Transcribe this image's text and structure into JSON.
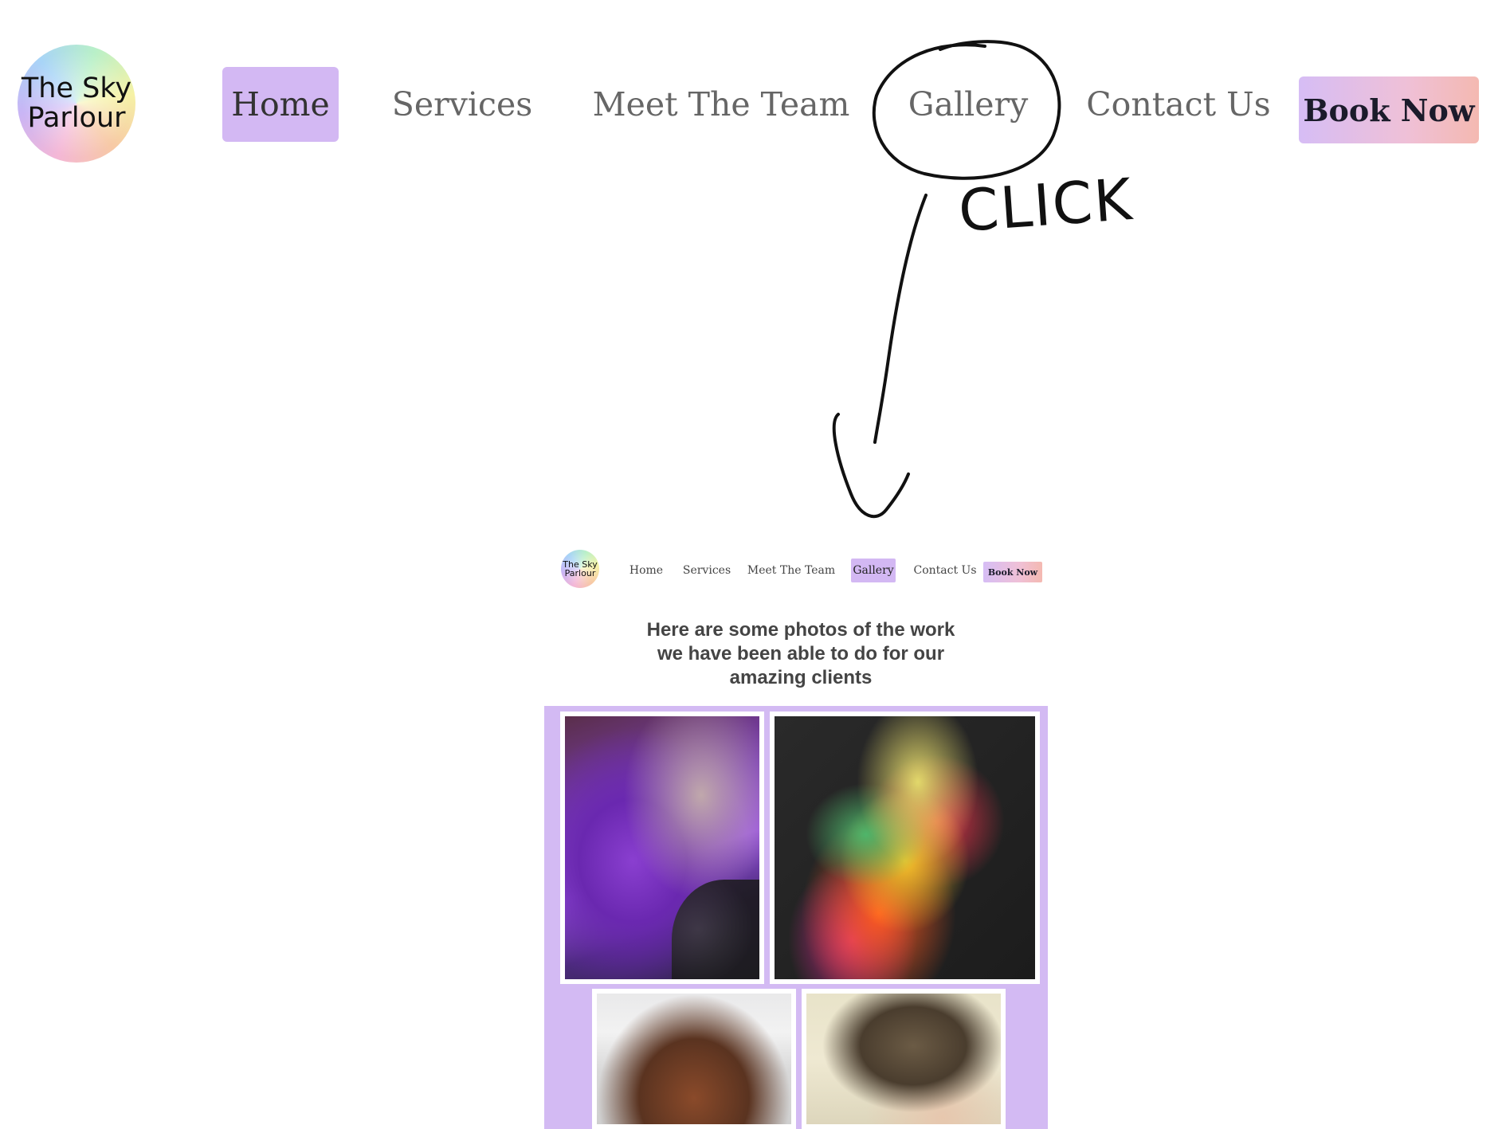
{
  "header_large": {
    "logo": {
      "line1": "The Sky",
      "line2": "Parlour"
    },
    "nav": {
      "home": "Home",
      "services": "Services",
      "team": "Meet The Team",
      "gallery": "Gallery",
      "contact": "Contact Us",
      "book": "Book Now"
    },
    "active_item": "Home"
  },
  "annotation": {
    "text": "CLICK"
  },
  "preview": {
    "logo": {
      "line1": "The Sky",
      "line2": "Parlour"
    },
    "nav": {
      "home": "Home",
      "services": "Services",
      "team": "Meet The Team",
      "gallery": "Gallery",
      "contact": "Contact Us",
      "book": "Book Now"
    },
    "active_item": "Gallery",
    "heading": {
      "line1": "Here are some photos of the work",
      "line2": "we have been able to do for our",
      "line3": "amazing clients"
    }
  },
  "colors": {
    "active_nav": "#d3b8f3",
    "gallery_panel": "#d3baf3",
    "book_gradient_start": "#d6bdf5",
    "book_gradient_end": "#f4b9b1"
  }
}
